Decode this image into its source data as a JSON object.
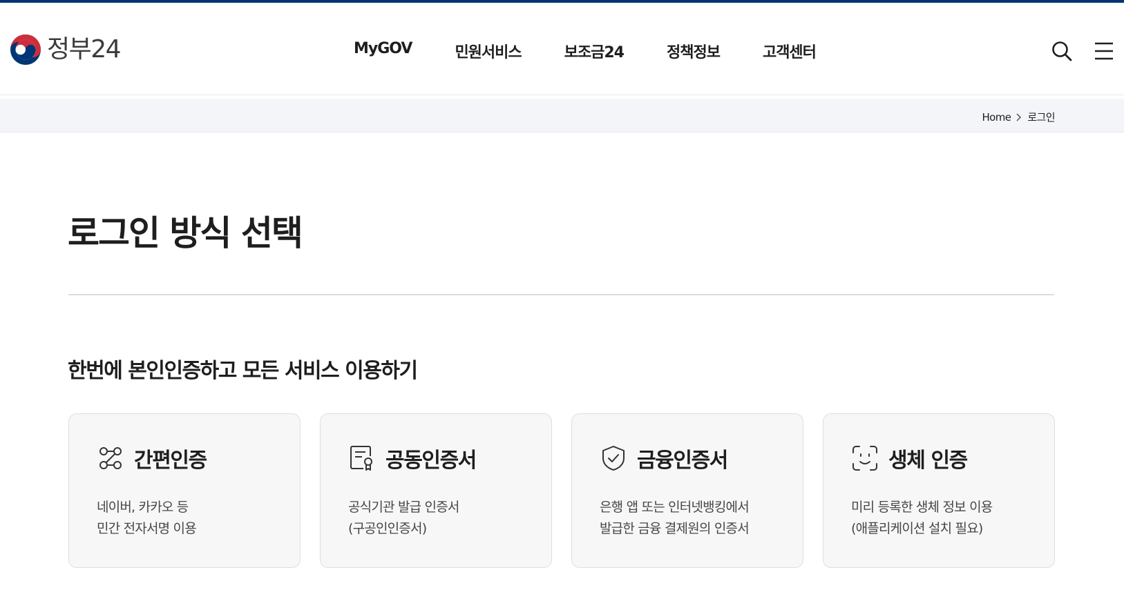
{
  "header": {
    "logo_text": "정부24",
    "nav": [
      "MyGOV",
      "민원서비스",
      "보조금24",
      "정책정보",
      "고객센터"
    ],
    "icons": {
      "search": "search-icon",
      "menu": "hamburger-menu-icon"
    }
  },
  "breadcrumb": {
    "home": "Home",
    "current": "로그인"
  },
  "page": {
    "title": "로그인 방식 선택",
    "section_title": "한번에 본인인증하고 모든 서비스 이용하기"
  },
  "cards": [
    {
      "title": "간편인증",
      "icon": "connected-nodes-icon",
      "desc_line1": "네이버, 카카오 등",
      "desc_line2": "민간 전자서명 이용"
    },
    {
      "title": "공동인증서",
      "icon": "certificate-icon",
      "desc_line1": "공식기관 발급 인증서",
      "desc_line2": "(구공인인증서)"
    },
    {
      "title": "금융인증서",
      "icon": "shield-check-icon",
      "desc_line1": "은행 앱 또는 인터넷뱅킹에서",
      "desc_line2": "발급한 금융 결제원의 인증서"
    },
    {
      "title": "생체 인증",
      "icon": "face-id-icon",
      "desc_line1": "미리 등록한 생체 정보 이용",
      "desc_line2": "(애플리케이션 설치 필요)"
    }
  ],
  "colors": {
    "brand_navy": "#003675",
    "brand_red": "#cd2e3a",
    "text": "#1e1e1e",
    "card_bg": "#f7f7f8",
    "breadcrumb_bg": "#f4f5f8"
  }
}
